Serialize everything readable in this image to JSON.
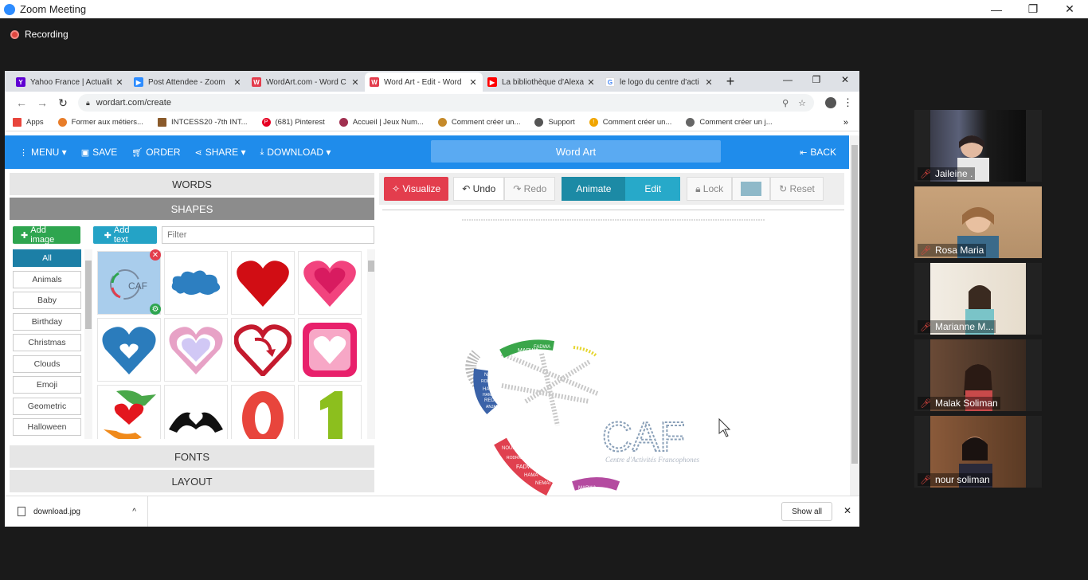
{
  "zoom": {
    "title": "Zoom Meeting",
    "recording_label": "Recording",
    "participants": [
      {
        "name": "Jaileine ."
      },
      {
        "name": "Rosa Maria"
      },
      {
        "name": "Marianne M..."
      },
      {
        "name": "Malak Soliman"
      },
      {
        "name": "nour soliman"
      }
    ]
  },
  "browser": {
    "tabs": [
      {
        "label": "Yahoo France | Actualit",
        "icon": "yahoo-icon",
        "color": "#6001d2"
      },
      {
        "label": "Post Attendee - Zoom",
        "icon": "zoom-icon",
        "color": "#2d8cff"
      },
      {
        "label": "WordArt.com - Word C",
        "icon": "wordart-icon",
        "color": "#e33d4d"
      },
      {
        "label": "Word Art - Edit - Word",
        "icon": "wordart-icon",
        "color": "#e33d4d"
      },
      {
        "label": "La bibliothèque d'Alexa",
        "icon": "youtube-icon",
        "color": "#ff0000"
      },
      {
        "label": "le logo du centre d'acti",
        "icon": "google-icon",
        "color": "#4285f4"
      }
    ],
    "url": "wordart.com/create",
    "bookmarks": [
      {
        "label": "Apps",
        "color": "#e8453c"
      },
      {
        "label": "Former aux métiers...",
        "color": "#e87d2a"
      },
      {
        "label": "INTCESS20 -7th INT...",
        "color": "#8a5a2b"
      },
      {
        "label": "(681) Pinterest",
        "color": "#e60023"
      },
      {
        "label": "Accueil | Jeux Num...",
        "color": "#a03050"
      },
      {
        "label": "Comment créer un...",
        "color": "#c58a2a"
      },
      {
        "label": "Support",
        "color": "#555555"
      },
      {
        "label": "Comment créer un...",
        "color": "#f0a500"
      },
      {
        "label": "Comment créer un j...",
        "color": "#666666"
      }
    ]
  },
  "wordart": {
    "menu": "MENU",
    "save": "SAVE",
    "order": "ORDER",
    "share": "SHARE",
    "download": "DOWNLOAD",
    "title": "Word Art",
    "back": "BACK",
    "sections": {
      "words": "WORDS",
      "shapes": "SHAPES",
      "fonts": "FONTS",
      "layout": "LAYOUT"
    },
    "add_image": "Add image",
    "add_text": "Add text",
    "filter_placeholder": "Filter",
    "categories": [
      "All",
      "Animals",
      "Baby",
      "Birthday",
      "Christmas",
      "Clouds",
      "Emoji",
      "Geometric",
      "Halloween"
    ],
    "toolbar": {
      "visualize": "Visualize",
      "undo": "Undo",
      "redo": "Redo",
      "animate": "Animate",
      "edit": "Edit",
      "lock": "Lock",
      "reset": "Reset"
    },
    "canvas_text": {
      "logo": "CAF",
      "sub": "Centre d'Activités Francophones",
      "words": [
        "MARWA",
        "FADWA",
        "NOUR",
        "HAMA",
        "REDA",
        "MAY",
        "RODR",
        "HAMA",
        "ANJANA",
        "NOUR",
        "RODRIGUES",
        "FADWA",
        "HAMA",
        "NEMAT",
        "MARWA"
      ]
    },
    "colors": {
      "toolbar": "#1f8ceb",
      "visualize": "#e33d4d",
      "animate": "#1c8aa5",
      "edit": "#27a9c9",
      "add_image": "#2ea54f",
      "add_text": "#24a3c6"
    }
  },
  "downloads": {
    "file": "download.jpg",
    "show_all": "Show all"
  }
}
